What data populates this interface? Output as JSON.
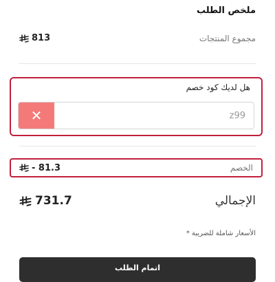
{
  "summary": {
    "title": "ملخص الطلب",
    "subtotal_label": "مجموع المنتجات",
    "subtotal_value": "813"
  },
  "coupon": {
    "label": "هل لديك كود خصم",
    "value": "z99",
    "clear_icon": "close-icon",
    "clear_symbol": "✕"
  },
  "discount": {
    "label": "الخصم",
    "value": "- 81.3"
  },
  "total": {
    "label": "الإجمالي",
    "value": "731.7"
  },
  "tax_note": "* الأسعار شاملة للضريبة",
  "checkout_label": "اتمام الطلب",
  "currency_icon": "saudi-riyal-icon",
  "colors": {
    "highlight_border": "#c01f3a",
    "clear_button": "#f47a7a",
    "checkout_button": "#2e2e2e"
  }
}
